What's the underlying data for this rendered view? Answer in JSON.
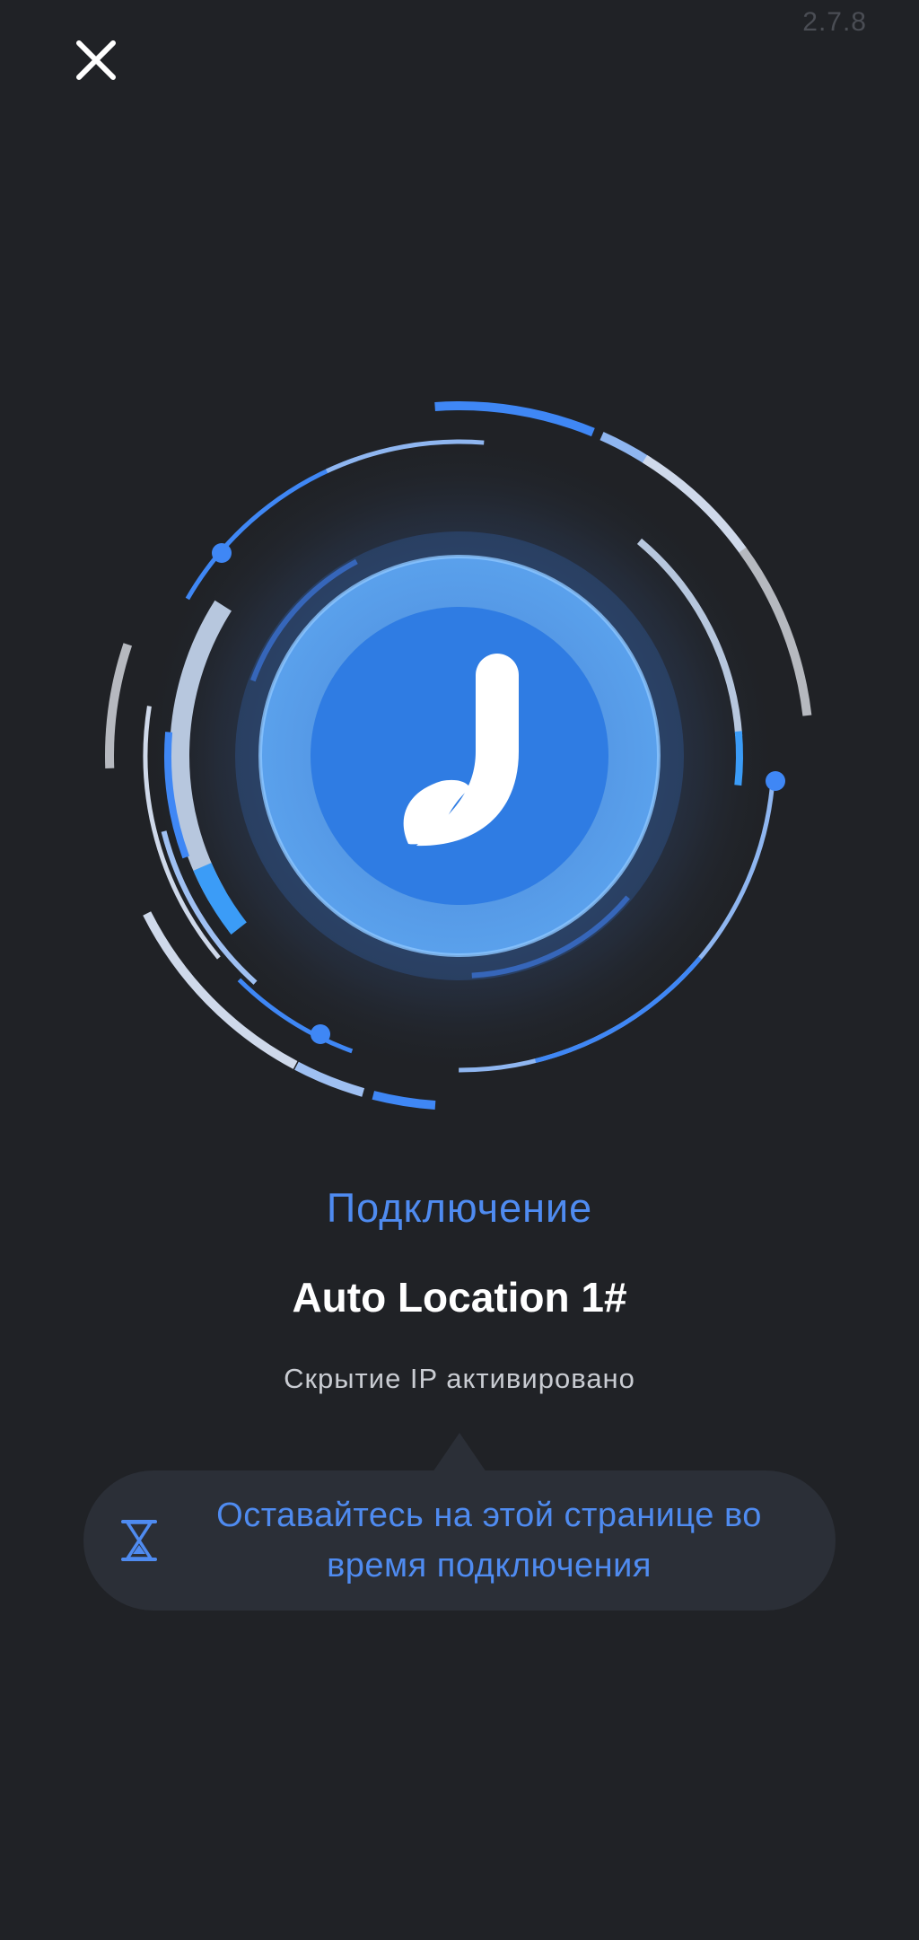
{
  "header": {
    "version": "2.7.8",
    "close_icon": "close-icon"
  },
  "connection": {
    "logo_icon": "j-leaf-logo-icon",
    "status": "Подключение",
    "location": "Auto Location 1#",
    "ip_status": "Скрытие IP активировано"
  },
  "tooltip": {
    "icon": "hourglass-icon",
    "text": "Оставайтесь на этой странице во время подключения"
  },
  "colors": {
    "background": "#202226",
    "accent": "#4f8bf0",
    "logo_circle": "#2f7ce3",
    "tooltip_bg": "#2b2f37"
  }
}
